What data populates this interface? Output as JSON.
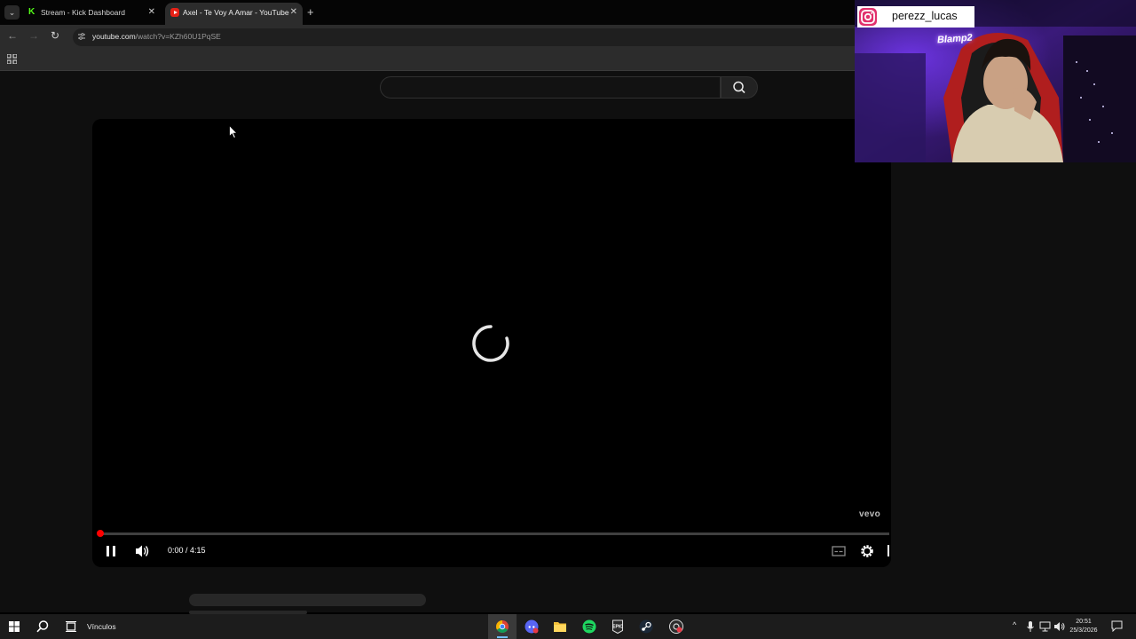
{
  "browser": {
    "tabs": [
      {
        "title": "Stream - Kick Dashboard",
        "active": false
      },
      {
        "title": "Axel - Te Voy A Amar - YouTube",
        "active": true
      }
    ],
    "url_host": "youtube.com",
    "url_path": "/watch?v=KZh60U1PqSE"
  },
  "youtube": {
    "player": {
      "current_time": "0:00",
      "duration": "4:15",
      "time_display": "0:00 / 4:15",
      "progress_fraction": 0.0,
      "watermark": "vevo",
      "state": "loading"
    }
  },
  "overlay": {
    "instagram_handle": "perezz_lucas",
    "neon_sign": "Blamp2"
  },
  "taskbar": {
    "search_label": "Vínculos",
    "time": "20:51",
    "date": "25/3/2026"
  },
  "colors": {
    "accent_red": "#ff0000",
    "kick_green": "#53fc18",
    "chrome_bg": "#2c2c2c"
  }
}
